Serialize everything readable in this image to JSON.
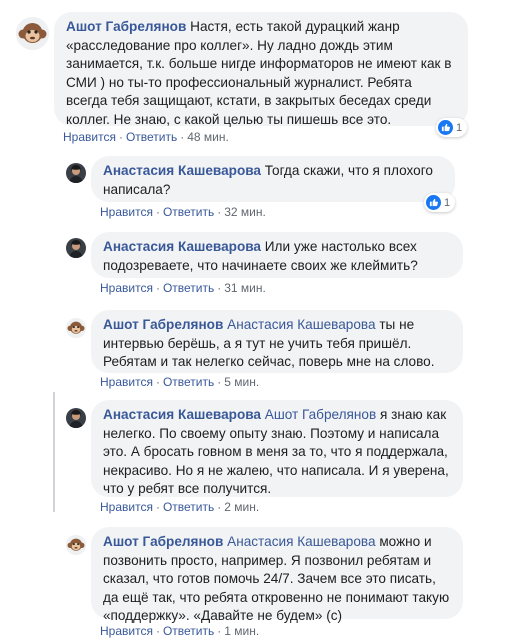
{
  "comments": [
    {
      "author": "Ашот Габрелянов",
      "mention": "",
      "text": "Настя, есть такой дурацкий жанр «расследование про коллег». Ну ладно дождь этим занимается, т.к. больше нигде информаторов не имеют как в СМИ ) но ты-то профессиональный журналист. Ребята всегда тебя защищают, кстати, в закрытых беседах среди коллег. Не знаю, с какой целью ты пишешь все это.",
      "like": "Нравится",
      "reply": "Ответить",
      "time": "48 мин.",
      "reactions": "1"
    },
    {
      "author": "Анастасия Кашеварова",
      "mention": "",
      "text": "Тогда скажи, что я плохого написала?",
      "like": "Нравится",
      "reply": "Ответить",
      "time": "32 мин.",
      "reactions": "1"
    },
    {
      "author": "Анастасия Кашеварова",
      "mention": "",
      "text": "Или уже настолько всех подозреваете, что начинаете своих же клеймить?",
      "like": "Нравится",
      "reply": "Ответить",
      "time": "31 мин."
    },
    {
      "author": "Ашот Габрелянов",
      "mention": "Анастасия Кашеварова",
      "text": "ты не интервью берёшь, а я тут не учить тебя пришёл. Ребятам и так нелегко сейчас, поверь мне на слово.",
      "like": "Нравится",
      "reply": "Ответить",
      "time": "5 мин."
    },
    {
      "author": "Анастасия Кашеварова",
      "mention": "Ашот Габрелянов",
      "text": "я знаю как нелегко. По своему опыту знаю. Поэтому и написала это. А бросать говном в меня за то, что я поддержала, некрасиво. Но я не жалею, что написала. И я уверена, что у ребят все получится.",
      "like": "Нравится",
      "reply": "Ответить",
      "time": "2 мин."
    },
    {
      "author": "Ашот Габрелянов",
      "mention": "Анастасия Кашеварова",
      "text": "можно и позвонить просто, например. Я позвонил ребятам и сказал, что готов помочь 24/7. Зачем все это писать, да ещё так, что ребята откровенно не понимают такую «поддержку». «Давайте не будем» (с)",
      "like": "Нравится",
      "reply": "Ответить",
      "time": "1 мин."
    }
  ],
  "separator": "·",
  "colors": {
    "link": "#385898",
    "bubble": "#f2f3f5",
    "like_blue": "#1877f2",
    "meta_gray": "#606770"
  },
  "icons": {
    "reaction": "like-thumb-icon",
    "avatar_ashot": "monkey-avatar-icon",
    "avatar_nastya": "person-avatar-icon"
  }
}
